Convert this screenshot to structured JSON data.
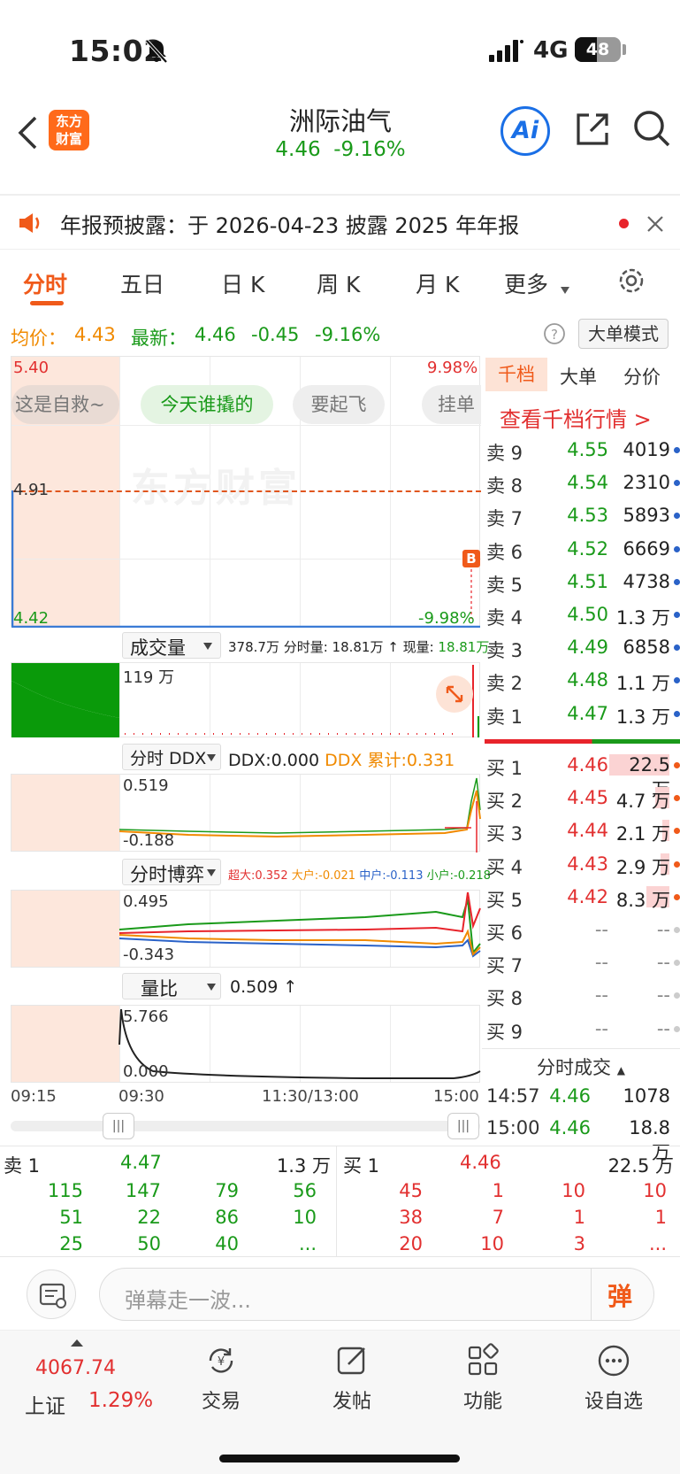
{
  "status": {
    "time": "15:02",
    "network": "4G",
    "battery": "48"
  },
  "nav": {
    "logo_line1": "东方",
    "logo_line2": "财富",
    "title": "洲际油气",
    "price": "4.46",
    "change": "-9.16%",
    "ai_label": "Ai"
  },
  "notice": {
    "text": "年报预披露：于 2026-04-23 披露 2025 年年报"
  },
  "tabs": [
    "分时",
    "五日",
    "日 K",
    "周 K",
    "月 K",
    "更多"
  ],
  "info": {
    "avg_label": "均价：",
    "avg": "4.43",
    "latest_label": "最新：",
    "latest": "4.46",
    "chg": "-0.45",
    "pct": "-9.16%",
    "mode_btn": "大单模式"
  },
  "price_chart": {
    "top": "5.40",
    "top_pct": "9.98%",
    "mid": "4.91",
    "bottom": "4.42",
    "bottom_pct": "-9.98%",
    "watermark": "东方财富",
    "b_marker": "B",
    "bubbles": [
      "这是自救~",
      "今天谁撬的",
      "要起飞",
      "挂单"
    ]
  },
  "volume": {
    "selector": "成交量",
    "summary": "378.7万 分时量: 18.81万 ↑ 现量: ",
    "now_value": "18.81万",
    "max": "119 万"
  },
  "ddx": {
    "selector": "分时 DDX",
    "ddx": "DDX:0.000",
    "acc": "DDX 累计:0.331",
    "max": "0.519",
    "min": "-0.188"
  },
  "game": {
    "selector": "分时博弈",
    "super": "超大:0.352",
    "big": "大户:-0.021",
    "mid": "中户:-0.113",
    "small": "小户:-0.218",
    "max": "0.495",
    "min": "-0.343"
  },
  "ratio": {
    "selector": "量比",
    "value": "0.509 ↑",
    "max": "5.766",
    "min": "0.000"
  },
  "time_axis": [
    "09:15",
    "09:30",
    "11:30/13:00",
    "15:00"
  ],
  "book": {
    "tabs": [
      "千档",
      "大单",
      "分价"
    ],
    "link": "查看千档行情 >",
    "sells": [
      {
        "label": "卖 9",
        "price": "4.55",
        "vol": "4019"
      },
      {
        "label": "卖 8",
        "price": "4.54",
        "vol": "2310"
      },
      {
        "label": "卖 7",
        "price": "4.53",
        "vol": "5893"
      },
      {
        "label": "卖 6",
        "price": "4.52",
        "vol": "6669"
      },
      {
        "label": "卖 5",
        "price": "4.51",
        "vol": "4738"
      },
      {
        "label": "卖 4",
        "price": "4.50",
        "vol": "1.3 万"
      },
      {
        "label": "卖 3",
        "price": "4.49",
        "vol": "6858"
      },
      {
        "label": "卖 2",
        "price": "4.48",
        "vol": "1.1 万"
      },
      {
        "label": "卖 1",
        "price": "4.47",
        "vol": "1.3 万"
      }
    ],
    "buys": [
      {
        "label": "买 1",
        "price": "4.46",
        "vol": "22.5 万"
      },
      {
        "label": "买 2",
        "price": "4.45",
        "vol": "4.7 万"
      },
      {
        "label": "买 3",
        "price": "4.44",
        "vol": "2.1 万"
      },
      {
        "label": "买 4",
        "price": "4.43",
        "vol": "2.9 万"
      },
      {
        "label": "买 5",
        "price": "4.42",
        "vol": "8.3 万"
      },
      {
        "label": "买 6",
        "price": "--",
        "vol": "--"
      },
      {
        "label": "买 7",
        "price": "--",
        "vol": "--"
      },
      {
        "label": "买 8",
        "price": "--",
        "vol": "--"
      },
      {
        "label": "买 9",
        "price": "--",
        "vol": "--"
      }
    ],
    "trades_header": "分时成交",
    "trades": [
      {
        "time": "14:57",
        "price": "4.46",
        "vol": "1078"
      },
      {
        "time": "15:00",
        "price": "4.46",
        "vol": "18.8 万"
      }
    ]
  },
  "depth": {
    "sell_label": "卖 1",
    "sell_price": "4.47",
    "sell_vol": "1.3 万",
    "buy_label": "买 1",
    "buy_price": "4.46",
    "buy_vol": "22.5 万",
    "sell_rows": [
      [
        "115",
        "147",
        "79",
        "56"
      ],
      [
        "51",
        "22",
        "86",
        "10"
      ],
      [
        "25",
        "50",
        "40",
        "..."
      ]
    ],
    "buy_rows": [
      [
        "45",
        "1",
        "10",
        "10"
      ],
      [
        "38",
        "7",
        "1",
        "1"
      ],
      [
        "20",
        "10",
        "3",
        "..."
      ]
    ]
  },
  "barrage": {
    "placeholder": "弹幕走一波...",
    "btn": "弹"
  },
  "bottom": {
    "index_value": "4067.74",
    "index_name": "上证",
    "index_pct": "1.29%",
    "items": [
      "交易",
      "发帖",
      "功能",
      "设自选"
    ]
  }
}
